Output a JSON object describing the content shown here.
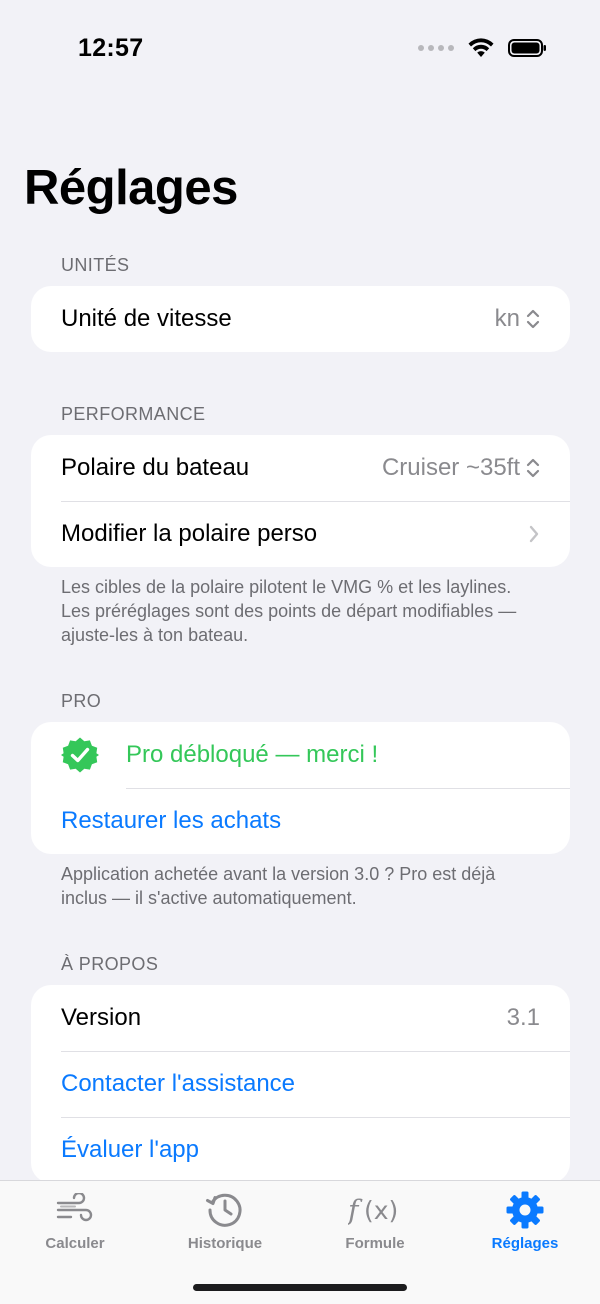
{
  "status_bar": {
    "time": "12:57"
  },
  "page": {
    "title": "Réglages"
  },
  "sections": {
    "units": {
      "header": "UNITÉS",
      "speed_unit_label": "Unité de vitesse",
      "speed_unit_value": "kn"
    },
    "performance": {
      "header": "PERFORMANCE",
      "polar_label": "Polaire du bateau",
      "polar_value": "Cruiser ~35ft",
      "edit_polar_label": "Modifier la polaire perso",
      "footer": "Les cibles de la polaire pilotent le VMG % et les laylines. Les préréglages sont des points de départ modifiables — ajuste-les à ton bateau."
    },
    "pro": {
      "header": "PRO",
      "unlocked_label": "Pro débloqué — merci !",
      "restore_label": "Restaurer les achats",
      "footer": "Application achetée avant la version 3.0 ? Pro est déjà inclus — il s'active automatiquement."
    },
    "about": {
      "header": "À PROPOS",
      "version_label": "Version",
      "version_value": "3.1",
      "contact_label": "Contacter l'assistance",
      "rate_label": "Évaluer l'app"
    }
  },
  "tab_bar": {
    "tabs": [
      {
        "label": "Calculer",
        "icon": "wind-icon"
      },
      {
        "label": "Historique",
        "icon": "history-clock-icon"
      },
      {
        "label": "Formule",
        "icon": "function-icon"
      },
      {
        "label": "Réglages",
        "icon": "gear-icon"
      }
    ],
    "active": "Réglages"
  },
  "colors": {
    "accent": "#0A7AFF",
    "success": "#34C759",
    "background": "#F2F2F7",
    "secondary_text": "#8A8A8E"
  }
}
